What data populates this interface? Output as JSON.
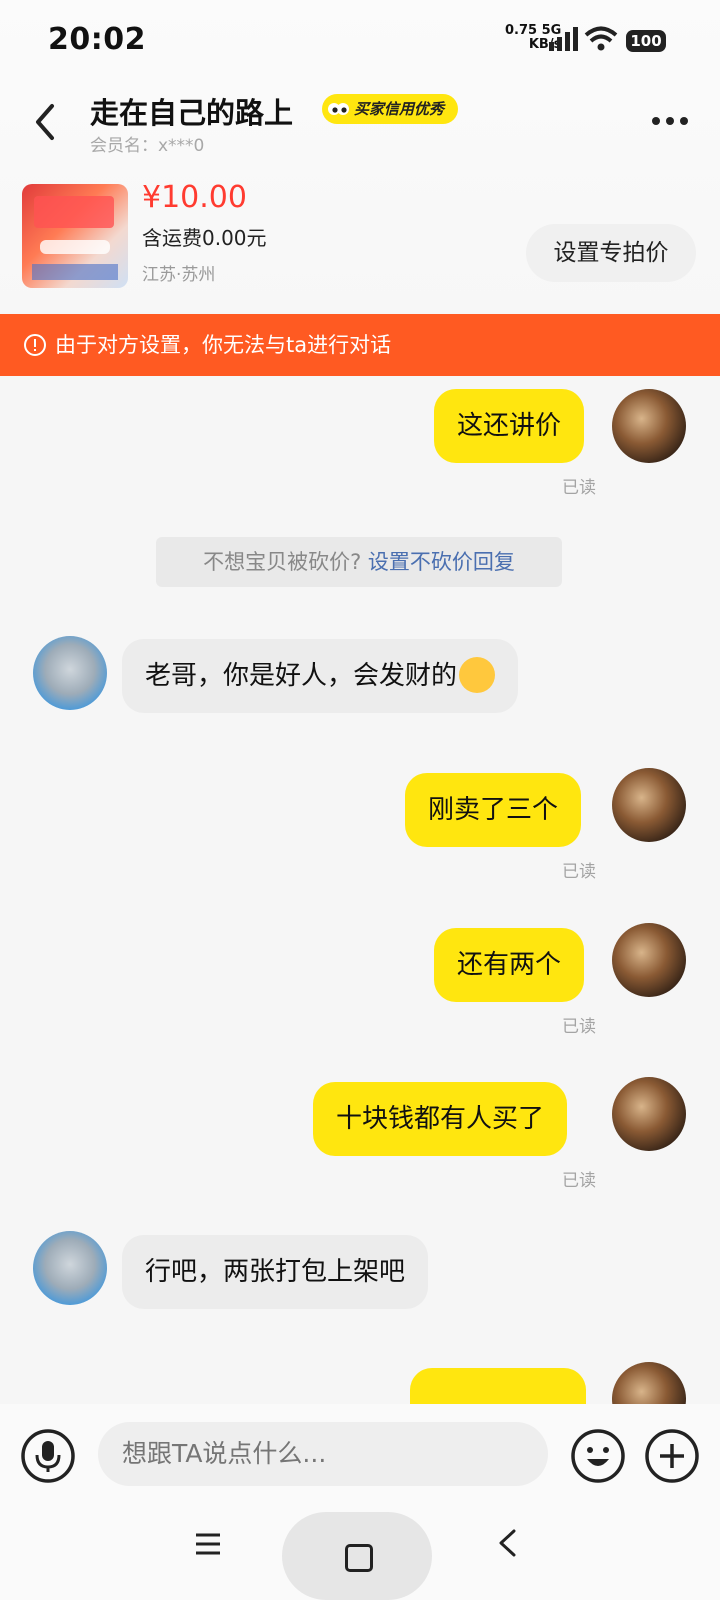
{
  "status": {
    "time": "20:02",
    "net_speed": "0.75",
    "net_unit": "KB/s",
    "net_type": "5G",
    "battery": "100"
  },
  "header": {
    "title": "走在自己的路上",
    "badge": "买家信用优秀",
    "member": "会员名：x***0"
  },
  "product": {
    "price": "¥10.00",
    "shipping": "含运费0.00元",
    "location": "江苏·苏州",
    "set_price_button": "设置专拍价"
  },
  "banner": {
    "text": "由于对方设置，你无法与ta进行对话"
  },
  "messages": {
    "m1": "这还讲价",
    "system_text": "不想宝贝被砍价?",
    "system_link": "设置不砍价回复",
    "m2": "老哥，你是好人，会发财的",
    "m3": "刚卖了三个",
    "m4": "还有两个",
    "m5": "十块钱都有人买了",
    "m6": "行吧，两张打包上架吧",
    "read_label": "已读"
  },
  "input": {
    "placeholder": "想跟TA说点什么..."
  },
  "colors": {
    "accent": "#ffe60f",
    "banner": "#ff5a22",
    "price": "#ff3b30"
  }
}
